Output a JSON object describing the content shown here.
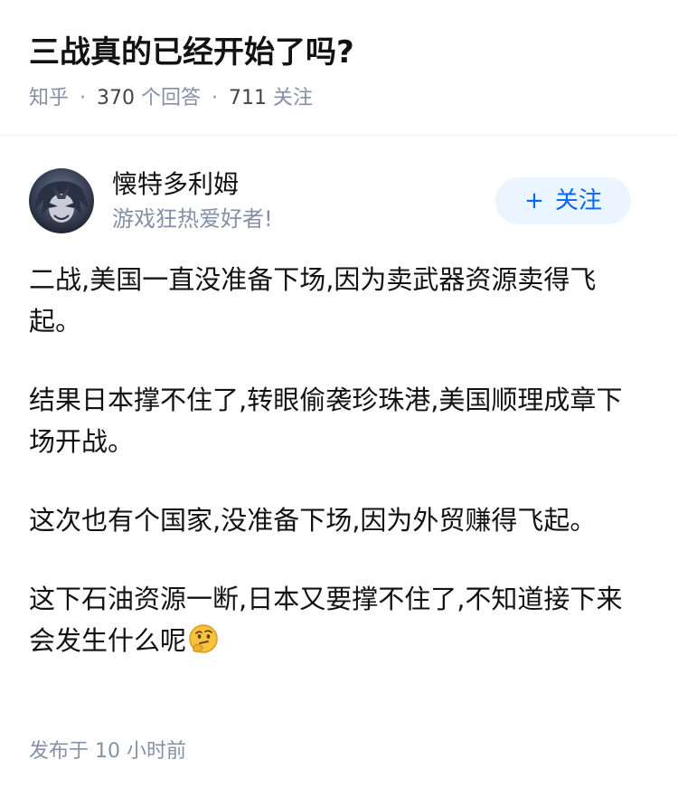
{
  "question": {
    "title": "三战真的已经开始了吗?",
    "source": "知乎",
    "separator": "·",
    "answers_count": "370",
    "answers_label": "个回答",
    "followers_count": "711",
    "followers_label": "关注"
  },
  "author": {
    "name": "懐特多利姆",
    "bio": "游戏狂热爱好者!",
    "follow_plus": "+",
    "follow_label": "关注"
  },
  "answer": {
    "paragraphs": [
      "二战,美国一直没准备下场,因为卖武器资源卖得飞起。",
      "结果日本撑不住了,转眼偷袭珍珠港,美国顺理成章下场开战。",
      "这次也有个国家,没准备下场,因为外贸赚得飞起。",
      "这下石油资源一断,日本又要撑不住了,不知道接下来会发生什么呢"
    ],
    "emoji": "thinking-face-icon"
  },
  "footer": {
    "published_label": "发布于",
    "time": "10 小时前"
  },
  "colors": {
    "text_primary": "#121212",
    "text_meta": "#8590a6",
    "accent": "#0066ff",
    "follow_bg": "#ebf5ff"
  }
}
